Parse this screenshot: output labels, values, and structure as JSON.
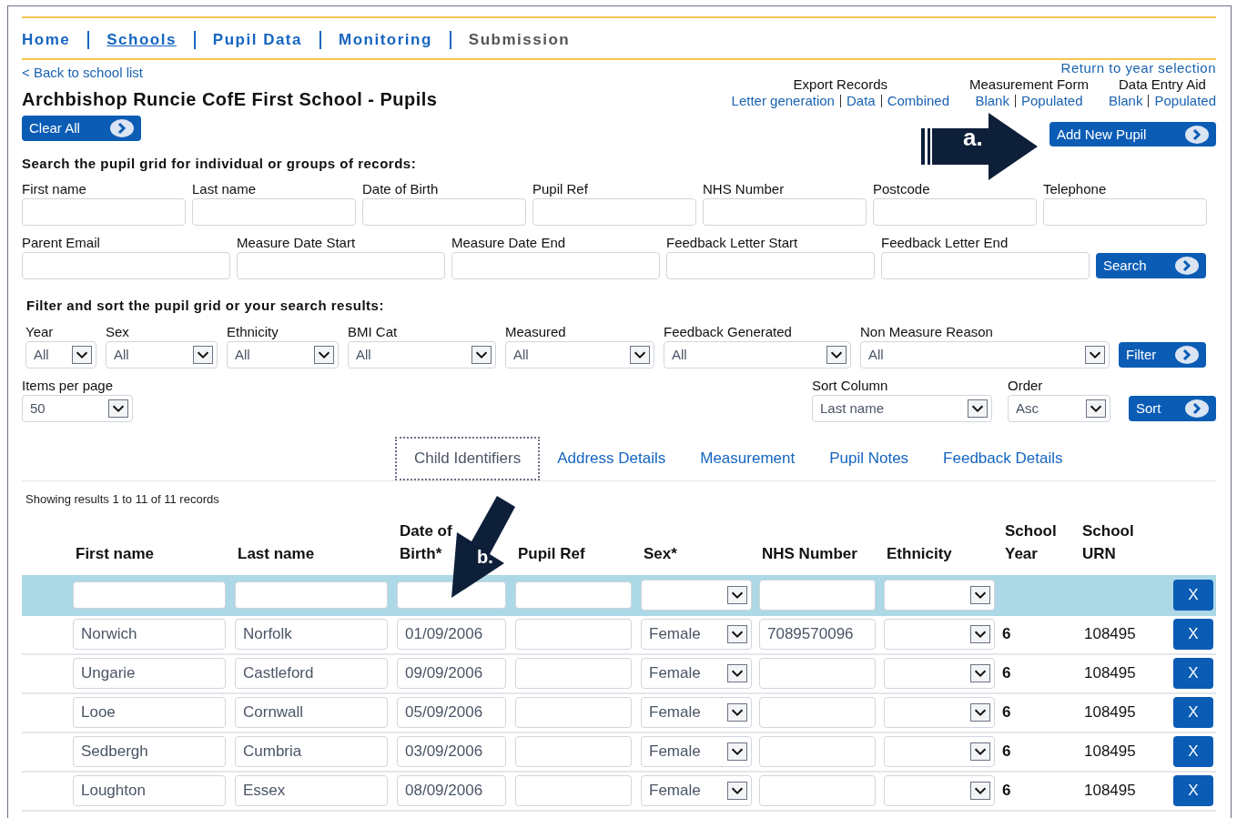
{
  "nav": [
    {
      "label": "Home",
      "selected": false,
      "disabled": false
    },
    {
      "label": "Schools",
      "selected": true,
      "disabled": false
    },
    {
      "label": "Pupil Data",
      "selected": false,
      "disabled": false
    },
    {
      "label": "Monitoring",
      "selected": false,
      "disabled": false
    },
    {
      "label": "Submission",
      "selected": false,
      "disabled": true
    }
  ],
  "back_link": "< Back to school list",
  "return_link": "Return to year selection",
  "title": "Archbishop Runcie CofE First School - Pupils",
  "clear_all_button": "Clear All",
  "link_groups": [
    {
      "title": "Export Records",
      "links": [
        "Letter generation",
        "Data",
        "Combined"
      ]
    },
    {
      "title": "Measurement Form",
      "links": [
        "Blank",
        "Populated"
      ]
    },
    {
      "title": "Data Entry Aid",
      "links": [
        "Blank",
        "Populated"
      ]
    }
  ],
  "add_new_pupil_button": "Add New Pupil",
  "callouts": [
    "a.",
    "b."
  ],
  "search": {
    "heading": "Search the pupil grid for individual or groups of records:",
    "fields_row_1": [
      "First name",
      "Last name",
      "Date of Birth",
      "Pupil Ref",
      "NHS Number",
      "Postcode",
      "Telephone"
    ],
    "fields_row_2": [
      "Parent Email",
      "Measure Date Start",
      "Measure Date End",
      "Feedback Letter Start",
      "Feedback Letter End"
    ],
    "button": "Search"
  },
  "filter": {
    "heading": "Filter and sort the pupil grid or your search results:",
    "selects": [
      {
        "label": "Year",
        "value": "All"
      },
      {
        "label": "Sex",
        "value": "All"
      },
      {
        "label": "Ethnicity",
        "value": "All"
      },
      {
        "label": "BMI Cat",
        "value": "All"
      },
      {
        "label": "Measured",
        "value": "All"
      },
      {
        "label": "Feedback Generated",
        "value": "All"
      },
      {
        "label": "Non Measure Reason",
        "value": "All"
      }
    ],
    "button": "Filter",
    "items_per_page": {
      "label": "Items per page",
      "value": "50"
    },
    "sort_column": {
      "label": "Sort Column",
      "value": "Last name"
    },
    "order": {
      "label": "Order",
      "value": "Asc"
    },
    "sort_button": "Sort"
  },
  "tabs": [
    {
      "label": "Child Identifiers",
      "selected": true
    },
    {
      "label": "Address Details",
      "selected": false
    },
    {
      "label": "Measurement",
      "selected": false
    },
    {
      "label": "Pupil Notes",
      "selected": false
    },
    {
      "label": "Feedback Details",
      "selected": false
    }
  ],
  "results_text": "Showing results 1 to 11 of 11 records",
  "table": {
    "columns": [
      "First name",
      "Last name",
      "Date of Birth*",
      "Pupil Ref",
      "Sex*",
      "NHS Number",
      "Ethnicity",
      "School Year",
      "School URN"
    ],
    "filter_row": {
      "clear": "X"
    },
    "rows": [
      {
        "first_name": "Norwich",
        "last_name": "Norfolk",
        "date_of_birth": "01/09/2006",
        "sex": "Female",
        "nhs_number": "7089570096",
        "school_year": "6",
        "school_urn": "108495",
        "delete": "X"
      },
      {
        "first_name": "Ungarie",
        "last_name": "Castleford",
        "date_of_birth": "09/09/2006",
        "sex": "Female",
        "school_year": "6",
        "school_urn": "108495",
        "delete": "X"
      },
      {
        "first_name": "Looe",
        "last_name": "Cornwall",
        "date_of_birth": "05/09/2006",
        "sex": "Female",
        "school_year": "6",
        "school_urn": "108495",
        "delete": "X"
      },
      {
        "first_name": "Sedbergh",
        "last_name": "Cumbria",
        "date_of_birth": "03/09/2006",
        "sex": "Female",
        "school_year": "6",
        "school_urn": "108495",
        "delete": "X"
      },
      {
        "first_name": "Loughton",
        "last_name": "Essex",
        "date_of_birth": "08/09/2006",
        "sex": "Female",
        "school_year": "6",
        "school_urn": "108495",
        "delete": "X"
      }
    ]
  }
}
